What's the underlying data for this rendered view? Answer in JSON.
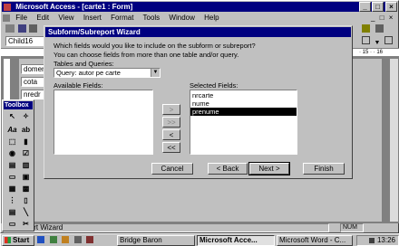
{
  "app": {
    "title": "Microsoft Access - [carte1 : Form]",
    "menu": [
      "File",
      "Edit",
      "View",
      "Insert",
      "Format",
      "Tools",
      "Window",
      "Help"
    ],
    "object_combo": "Child16",
    "font_size": "8",
    "status_text": "Subreport Wizard",
    "status_num": "NUM"
  },
  "form_fields": [
    "domeni",
    "cota",
    "nredr"
  ],
  "toolbox": {
    "title": "Toolbox"
  },
  "wizard": {
    "title": "Subform/Subreport Wizard",
    "intro1": "Which fields would you like to include on the subform or subreport?",
    "intro2": "You can choose fields from more than one table and/or query.",
    "tables_label": "Tables and Queries:",
    "tables_value": "Query: autor pe carte",
    "available_label": "Available Fields:",
    "selected_label": "Selected Fields:",
    "selected_fields": [
      "nrcarte",
      "nume",
      "prenume"
    ],
    "buttons": {
      "cancel": "Cancel",
      "back": "< Back",
      "next": "Next >",
      "finish": "Finish"
    },
    "move_one": ">",
    "move_all": ">>",
    "remove_one": "<",
    "remove_all": "<<"
  },
  "taskbar": {
    "start": "Start",
    "items": [
      "Bridge Baron",
      "Microsoft Acce...",
      "Microsoft Word - C..."
    ],
    "clock": "13:26"
  },
  "colors": {
    "desktop": "#008080",
    "titlebar": "#000080",
    "face": "#c0c0c0"
  }
}
